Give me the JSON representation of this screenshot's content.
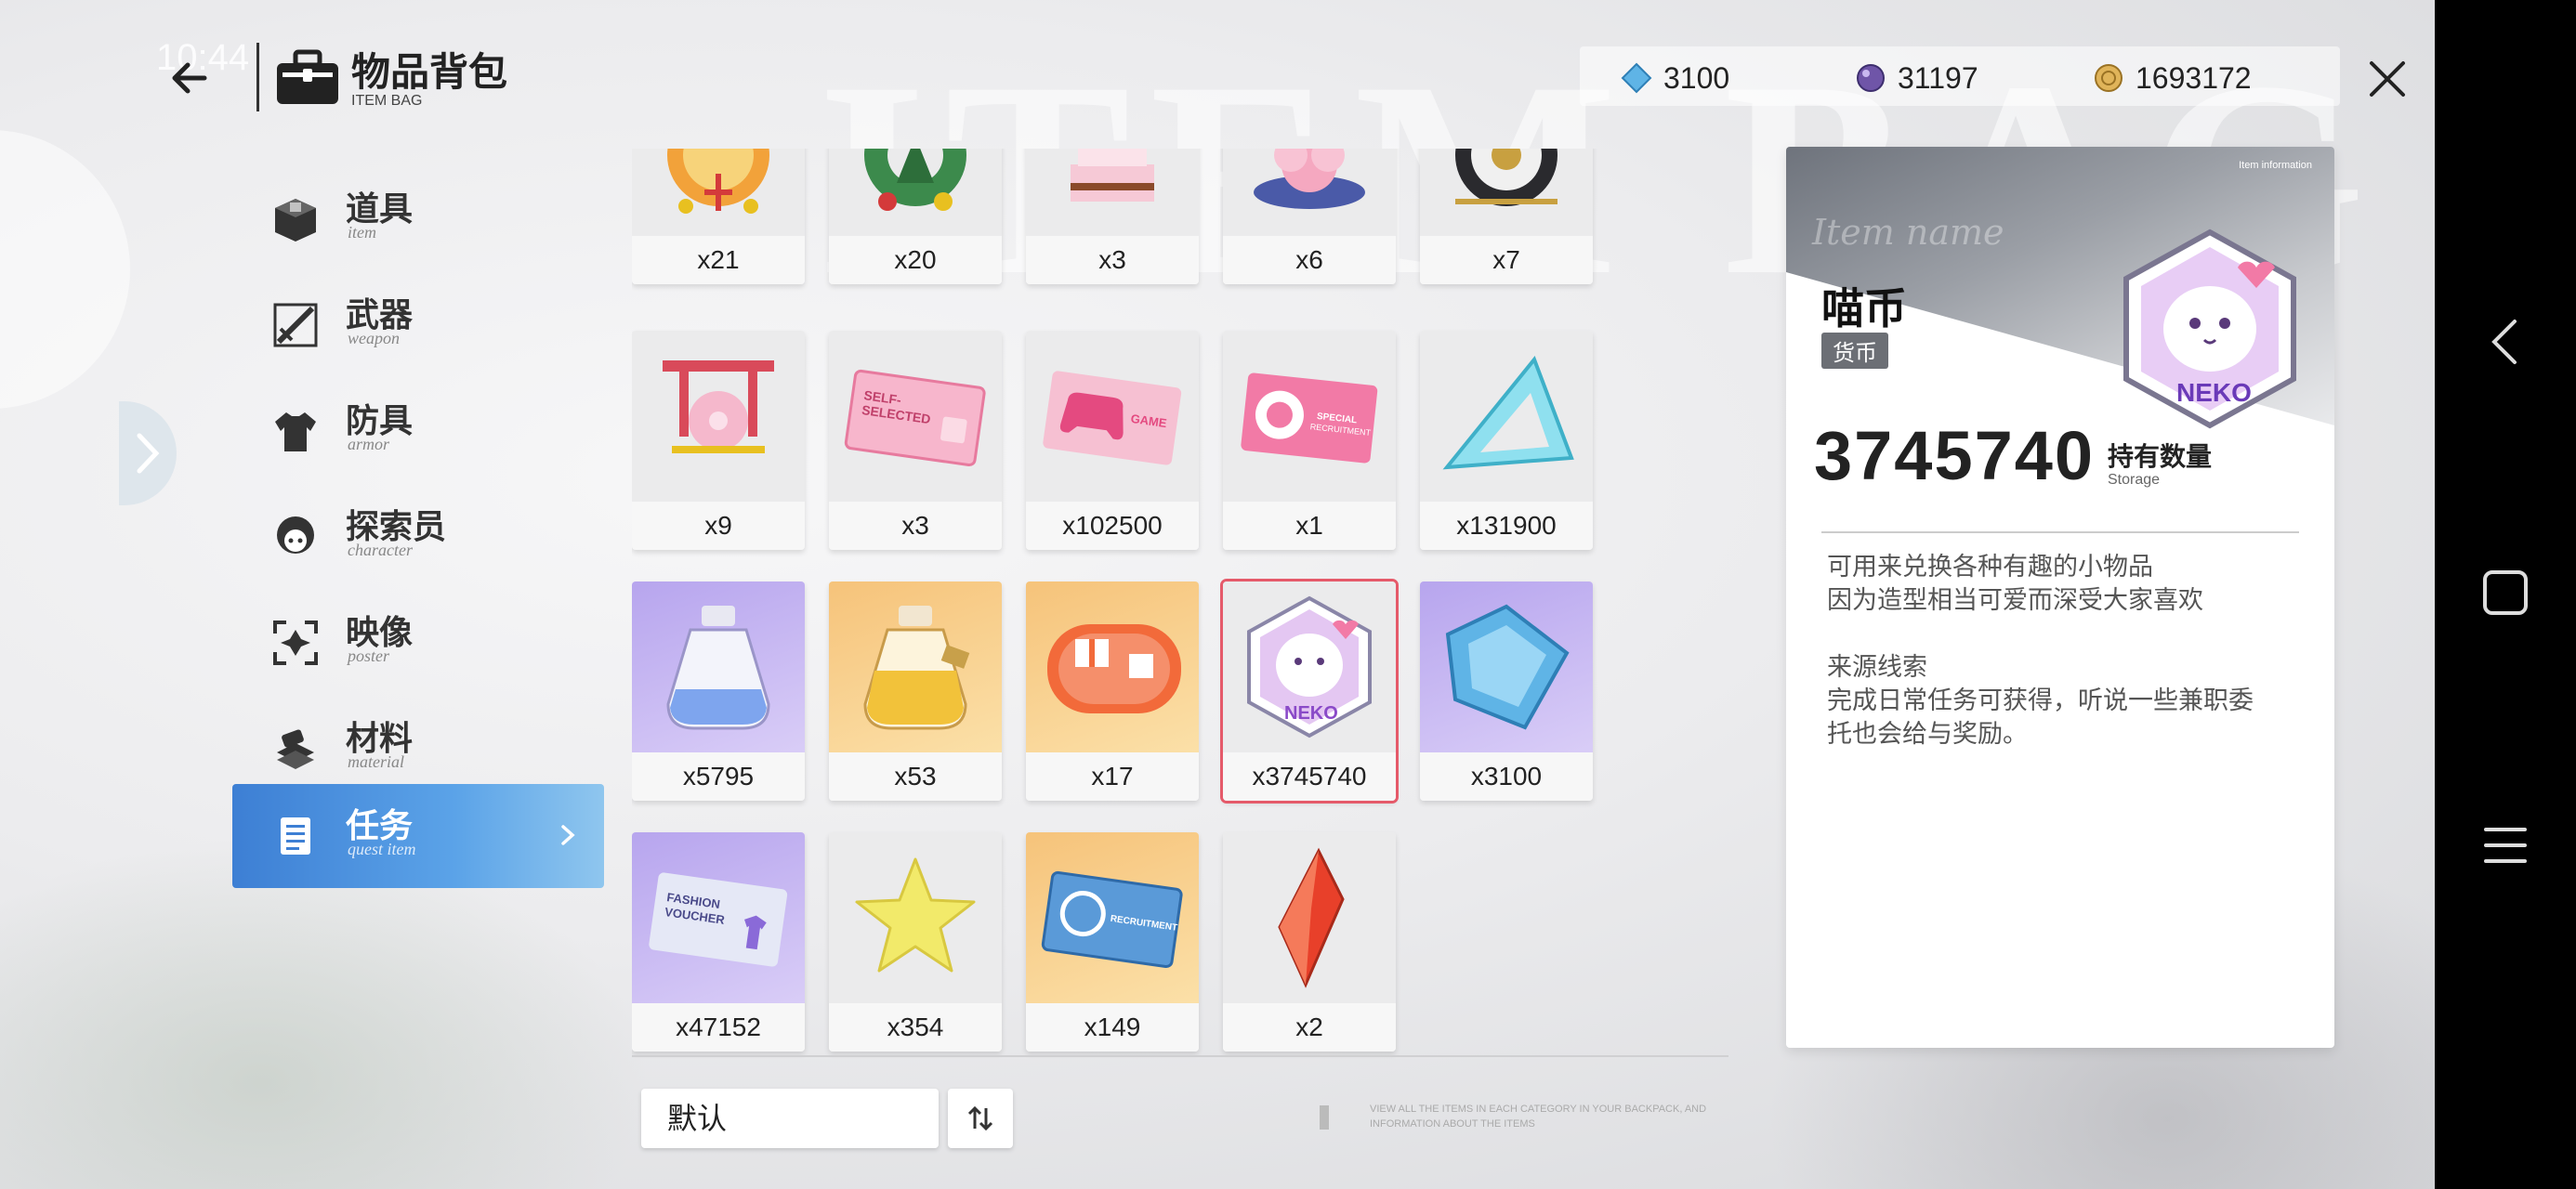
{
  "status": {
    "time": "10:44"
  },
  "header": {
    "title": "物品背包",
    "subtitle": "ITEM BAG"
  },
  "currencies": [
    {
      "icon": "blue-diamond-icon",
      "value": "3100"
    },
    {
      "icon": "purple-orb-icon",
      "value": "31197"
    },
    {
      "icon": "gold-coin-icon",
      "value": "1693172"
    }
  ],
  "sidebar": {
    "items": [
      {
        "zh": "道具",
        "en": "item",
        "icon": "item-box-icon"
      },
      {
        "zh": "武器",
        "en": "weapon",
        "icon": "sword-icon"
      },
      {
        "zh": "防具",
        "en": "armor",
        "icon": "shirt-icon"
      },
      {
        "zh": "探索员",
        "en": "character",
        "icon": "character-head-icon"
      },
      {
        "zh": "映像",
        "en": "poster",
        "icon": "poster-icon"
      },
      {
        "zh": "材料",
        "en": "material",
        "icon": "material-stack-icon"
      },
      {
        "zh": "任务",
        "en": "quest item",
        "icon": "quest-list-icon",
        "active": true
      }
    ]
  },
  "grid": {
    "rows": [
      [
        {
          "count": "x21",
          "style": "gray",
          "icon": "festive-ornament-icon"
        },
        {
          "count": "x20",
          "style": "gray",
          "icon": "christmas-wreath-icon"
        },
        {
          "count": "x3",
          "style": "gray",
          "icon": "cake-icon"
        },
        {
          "count": "x6",
          "style": "gray",
          "icon": "sakura-badge-icon"
        },
        {
          "count": "x7",
          "style": "gray",
          "icon": "clock-emblem-icon"
        }
      ],
      [
        {
          "count": "x9",
          "style": "gray",
          "icon": "torii-sakura-icon"
        },
        {
          "count": "x3",
          "style": "gray",
          "icon": "self-selected-ticket-icon",
          "label": "SELF-SELECTED"
        },
        {
          "count": "x102500",
          "style": "gray",
          "icon": "game-ticket-icon",
          "label": "GAME"
        },
        {
          "count": "x1",
          "style": "gray",
          "icon": "special-recruitment-ticket-icon",
          "label": "SPECIAL RECRUITMENT"
        },
        {
          "count": "x131900",
          "style": "gray",
          "icon": "triangle-crystal-icon"
        }
      ],
      [
        {
          "count": "x5795",
          "style": "purple",
          "icon": "blue-potion-bottle-icon"
        },
        {
          "count": "x53",
          "style": "gold",
          "icon": "gold-potion-bottle-icon"
        },
        {
          "count": "x17",
          "style": "gold",
          "icon": "gift-card-icon"
        },
        {
          "count": "x3745740",
          "style": "gray",
          "icon": "neko-coin-icon",
          "selected": true,
          "label": "NEKO"
        },
        {
          "count": "x3100",
          "style": "purple",
          "icon": "blue-diamond-icon"
        }
      ],
      [
        {
          "count": "x47152",
          "style": "purple",
          "icon": "fashion-voucher-icon",
          "label": "FASHION VOUCHER"
        },
        {
          "count": "x354",
          "style": "gray",
          "icon": "yellow-star-icon"
        },
        {
          "count": "x149",
          "style": "gold",
          "icon": "recruitment-voucher-icon",
          "label": "RECRUITMENT"
        },
        {
          "count": "x2",
          "style": "gray",
          "icon": "red-crystal-icon"
        }
      ]
    ]
  },
  "sort": {
    "selected": "默认"
  },
  "hint": "VIEW ALL THE ITEMS IN EACH CATEGORY IN YOUR BACKPACK, AND INFORMATION ABOUT THE ITEMS",
  "detail": {
    "info_label": "Item information",
    "script": "Item name",
    "name": "喵币",
    "tag": "货币",
    "art_label": "NEKO",
    "quantity": "3745740",
    "storage_zh": "持有数量",
    "storage_en": "Storage",
    "desc_lines": [
      "可用来兑换各种有趣的小物品",
      "因为造型相当可爱而深受大家喜欢"
    ],
    "source_title": "来源线索",
    "source_lines": [
      "完成日常任务可获得，听说一些兼职委",
      "托也会给与奖励。"
    ]
  },
  "colors": {
    "accent": "#3d7fd4",
    "selected": "#e55a6a"
  }
}
